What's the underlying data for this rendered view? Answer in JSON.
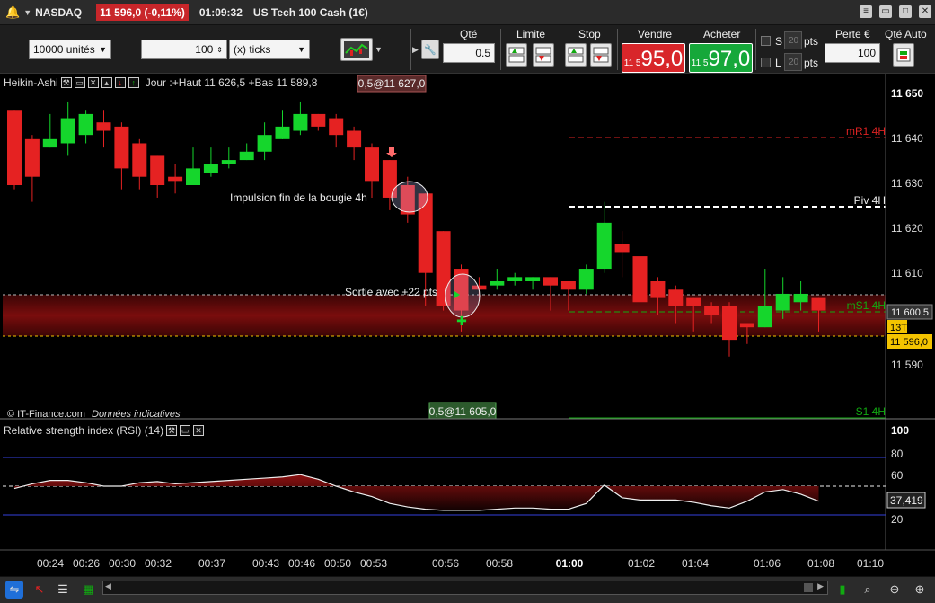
{
  "title_bar": {
    "instrument": "NASDAQ",
    "price_change": "11 596,0 (-0,11%)",
    "time": "01:09:32",
    "product": "US Tech 100 Cash (1€)"
  },
  "order_bar": {
    "units": "10000 unités",
    "ticks_value": "100",
    "ticks_unit": "(x) ticks",
    "qty_label": "Qté",
    "qty_value": "0.5",
    "limit_label": "Limite",
    "stop_label": "Stop",
    "sell_label": "Vendre",
    "sell_small": "11 5",
    "sell_big": "95,0",
    "buy_label": "Acheter",
    "buy_small": "11 5",
    "buy_big": "97,0",
    "s_label": "S",
    "l_label": "L",
    "s_pts": "20",
    "l_pts": "20",
    "pts": "pts",
    "loss_label": "Perte €",
    "loss_value": "100",
    "auto_qty_label": "Qté Auto"
  },
  "main_chart": {
    "indicator": "Heikin-Ashi",
    "day_info": "Jour :+Haut 11 626,5 +Bas 11 589,8",
    "order_top": "0,5@11 627,0",
    "order_bottom": "0,5@11 605,0",
    "annotation1": "Impulsion fin de la bougie 4h",
    "annotation2": "Sortie avec +22 pts",
    "source": "© IT-Finance.com",
    "source_note": "Données indicatives",
    "levels": {
      "mr1": "mR1 4H",
      "piv": "Piv 4H",
      "ms1": "mS1 4H",
      "s1": "S1 4H"
    },
    "y_ticks": [
      "11 650",
      "11 640",
      "11 630",
      "11 620",
      "11 610",
      "11 600",
      "11 590"
    ],
    "current_price": "11 600,5",
    "bid_price": "11 596,0",
    "tick_counter": "13T"
  },
  "rsi_panel": {
    "title": "Relative strength index (RSI) (14)",
    "y_ticks": [
      "100",
      "80",
      "60",
      "40",
      "20"
    ],
    "value": "37,419"
  },
  "x_axis": {
    "ticks": [
      "00:24",
      "00:26",
      "00:30",
      "00:32",
      "00:37",
      "00:43",
      "00:46",
      "00:50",
      "00:53",
      "00:56",
      "00:58",
      "01:00",
      "01:02",
      "01:04",
      "01:06",
      "01:08",
      "01:10"
    ]
  },
  "colors": {
    "up": "#15d62c",
    "down": "#e52222",
    "title_badge": "#c8262a",
    "sell": "#d8262a",
    "buy": "#16a83a",
    "rsi_zone": "#7a0d0d"
  },
  "chart_data": {
    "type": "candlestick",
    "style": "heikin-ashi",
    "ylim": [
      11585,
      11654
    ],
    "candles": [
      {
        "o": 11649,
        "c": 11631,
        "h": 11649,
        "l": 11630
      },
      {
        "o": 11642,
        "c": 11633,
        "h": 11643,
        "l": 11627
      },
      {
        "o": 11640,
        "c": 11642,
        "h": 11648,
        "l": 11640
      },
      {
        "o": 11641,
        "c": 11647,
        "h": 11651,
        "l": 11638
      },
      {
        "o": 11643,
        "c": 11648,
        "h": 11649,
        "l": 11641
      },
      {
        "o": 11646,
        "c": 11644,
        "h": 11649,
        "l": 11640
      },
      {
        "o": 11645,
        "c": 11635,
        "h": 11646,
        "l": 11630
      },
      {
        "o": 11641,
        "c": 11633,
        "h": 11642,
        "l": 11630
      },
      {
        "o": 11638,
        "c": 11631,
        "h": 11638,
        "l": 11628
      },
      {
        "o": 11633,
        "c": 11632,
        "h": 11636,
        "l": 11629
      },
      {
        "o": 11631,
        "c": 11635,
        "h": 11640,
        "l": 11631
      },
      {
        "o": 11634,
        "c": 11636,
        "h": 11640,
        "l": 11633
      },
      {
        "o": 11636,
        "c": 11637,
        "h": 11640,
        "l": 11635
      },
      {
        "o": 11637,
        "c": 11639,
        "h": 11641,
        "l": 11637
      },
      {
        "o": 11639,
        "c": 11643,
        "h": 11646,
        "l": 11637
      },
      {
        "o": 11642,
        "c": 11645,
        "h": 11649,
        "l": 11642
      },
      {
        "o": 11644,
        "c": 11648,
        "h": 11651,
        "l": 11643
      },
      {
        "o": 11648,
        "c": 11645,
        "h": 11648,
        "l": 11644
      },
      {
        "o": 11647,
        "c": 11643,
        "h": 11648,
        "l": 11640
      },
      {
        "o": 11644,
        "c": 11640,
        "h": 11645,
        "l": 11637
      },
      {
        "o": 11640,
        "c": 11632,
        "h": 11641,
        "l": 11628
      },
      {
        "o": 11637,
        "c": 11628,
        "h": 11637,
        "l": 11625
      },
      {
        "o": 11631,
        "c": 11624,
        "h": 11633,
        "l": 11622
      },
      {
        "o": 11629,
        "c": 11610,
        "h": 11629,
        "l": 11602
      },
      {
        "o": 11620,
        "c": 11602,
        "h": 11620,
        "l": 11601
      },
      {
        "o": 11611,
        "c": 11601,
        "h": 11612,
        "l": 11596
      },
      {
        "o": 11607,
        "c": 11606,
        "h": 11609,
        "l": 11604
      },
      {
        "o": 11607,
        "c": 11608,
        "h": 11611,
        "l": 11606
      },
      {
        "o": 11608,
        "c": 11609,
        "h": 11610,
        "l": 11607
      },
      {
        "o": 11608,
        "c": 11609,
        "h": 11609,
        "l": 11606
      },
      {
        "o": 11609,
        "c": 11607,
        "h": 11609,
        "l": 11601
      },
      {
        "o": 11608,
        "c": 11606,
        "h": 11608,
        "l": 11601
      },
      {
        "o": 11606,
        "c": 11611,
        "h": 11612,
        "l": 11605
      },
      {
        "o": 11611,
        "c": 11622,
        "h": 11627,
        "l": 11610
      },
      {
        "o": 11617,
        "c": 11615,
        "h": 11620,
        "l": 11609
      },
      {
        "o": 11614,
        "c": 11603,
        "h": 11614,
        "l": 11599
      },
      {
        "o": 11608,
        "c": 11604,
        "h": 11609,
        "l": 11600
      },
      {
        "o": 11606,
        "c": 11602,
        "h": 11607,
        "l": 11598
      },
      {
        "o": 11604,
        "c": 11602,
        "h": 11604,
        "l": 11596
      },
      {
        "o": 11602,
        "c": 11600,
        "h": 11603,
        "l": 11598
      },
      {
        "o": 11602,
        "c": 11594,
        "h": 11603,
        "l": 11590
      },
      {
        "o": 11598,
        "c": 11597,
        "h": 11598,
        "l": 11593
      },
      {
        "o": 11597,
        "c": 11602,
        "h": 11611,
        "l": 11597
      },
      {
        "o": 11601,
        "c": 11605,
        "h": 11609,
        "l": 11599
      },
      {
        "o": 11603,
        "c": 11605,
        "h": 11608,
        "l": 11601
      },
      {
        "o": 11604,
        "c": 11601,
        "h": 11604,
        "l": 11596
      }
    ],
    "rsi": [
      48,
      52,
      55,
      55,
      53,
      50,
      50,
      53,
      54,
      52,
      53,
      54,
      55,
      56,
      57,
      58,
      60,
      56,
      50,
      45,
      41,
      35,
      32,
      30,
      29,
      29,
      29,
      30,
      31,
      31,
      30,
      30,
      35,
      51,
      40,
      38,
      38,
      38,
      36,
      33,
      31,
      37,
      45,
      47,
      43,
      37
    ]
  }
}
